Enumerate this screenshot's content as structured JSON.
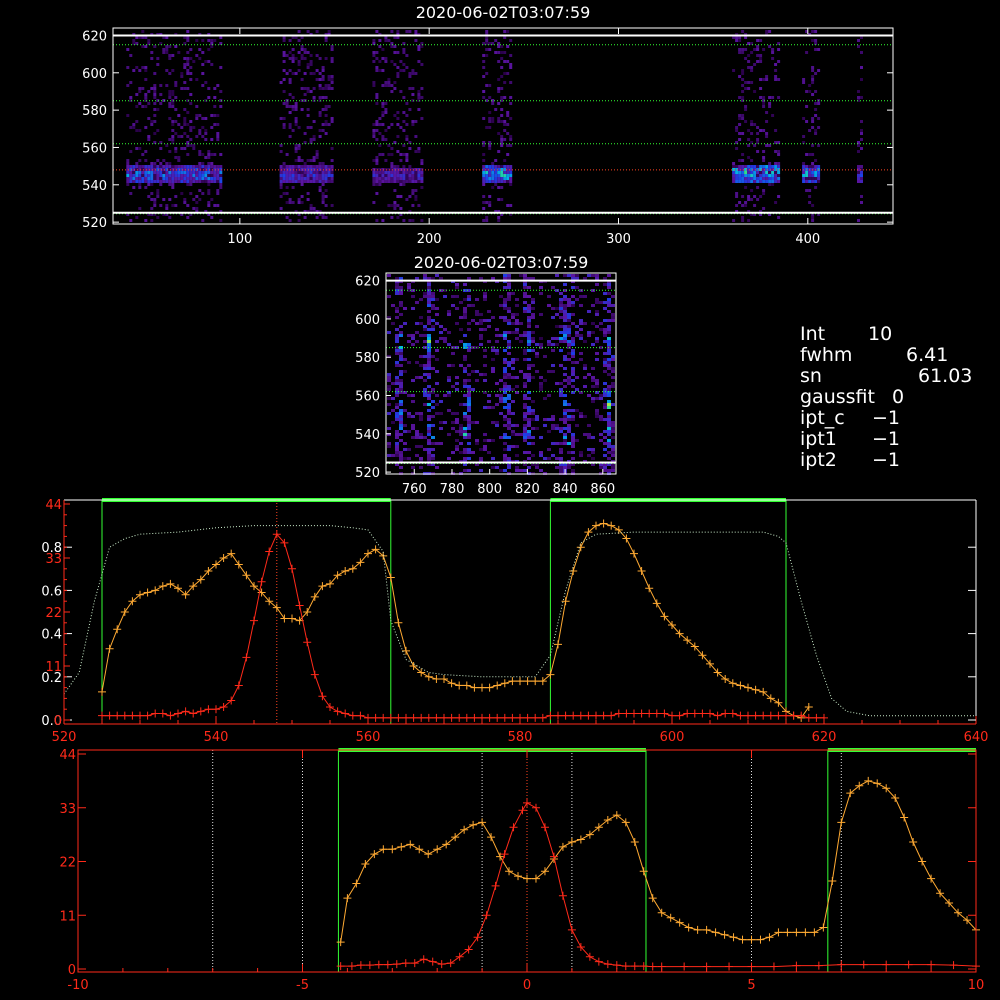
{
  "chart_data": [
    {
      "type": "heatmap",
      "title": "2020-06-02T03:07:59",
      "xlim": [
        33,
        445
      ],
      "ylim": [
        519,
        624
      ],
      "x_ticks": [
        100,
        200,
        300,
        400
      ],
      "y_ticks": [
        520,
        540,
        560,
        580,
        600,
        620
      ],
      "dotted_lines": [
        {
          "y": 615,
          "color": "#33ff33"
        },
        {
          "y": 585,
          "color": "#33ff33"
        },
        {
          "y": 562,
          "color": "#33ff33"
        },
        {
          "y": 548,
          "color": "#ff4422"
        },
        {
          "y": 524.5,
          "color": "#33ff33"
        }
      ],
      "solid_lines_y": [
        620,
        525
      ],
      "strips": [
        {
          "x0": 40,
          "x1": 90,
          "core": [
            541,
            551
          ],
          "intensity": 0.75
        },
        {
          "x0": 121,
          "x1": 148,
          "core": [
            541,
            551
          ],
          "intensity": 0.55
        },
        {
          "x0": 170,
          "x1": 196,
          "core": [
            542,
            550
          ],
          "intensity": 0.5
        },
        {
          "x0": 228,
          "x1": 243,
          "core": [
            542,
            551
          ],
          "intensity": 0.9
        },
        {
          "x0": 360,
          "x1": 384,
          "core": [
            542,
            552
          ],
          "intensity": 0.95
        },
        {
          "x0": 397,
          "x1": 406,
          "core": [
            542,
            551
          ],
          "intensity": 0.85
        },
        {
          "x0": 426,
          "x1": 429,
          "core": [
            542,
            551
          ],
          "intensity": 0.6
        }
      ]
    },
    {
      "type": "heatmap",
      "title": "2020-06-02T03:07:59",
      "xlim": [
        745,
        867
      ],
      "ylim": [
        519,
        624
      ],
      "x_ticks": [
        760,
        780,
        800,
        820,
        840,
        860
      ],
      "y_ticks": [
        520,
        540,
        560,
        580,
        600,
        620
      ],
      "dotted_lines": [
        {
          "y": 615,
          "color": "#33ff33"
        },
        {
          "y": 585,
          "color": "#33ff33"
        },
        {
          "y": 562,
          "color": "#33ff33"
        },
        {
          "y": 524.5,
          "color": "#33ff33"
        }
      ],
      "solid_lines_y": [
        620,
        525
      ],
      "hot_columns": [
        751,
        767,
        787,
        808,
        819,
        838,
        842,
        862
      ],
      "hot_rows": [
        557,
        588,
        540
      ]
    },
    {
      "type": "line",
      "xlim": [
        520,
        640
      ],
      "x_ticks": [
        520,
        540,
        560,
        580,
        600,
        620,
        640
      ],
      "left_axis_white": {
        "ylim": [
          0,
          1.0
        ],
        "ticks": [
          0.0,
          0.2,
          0.4,
          0.6,
          0.8
        ],
        "tick_labels": [
          "0.0",
          "0.2",
          "0.4",
          "0.6",
          "0.8"
        ]
      },
      "left_axis_red": {
        "ylim": [
          0,
          44
        ],
        "ticks": [
          0,
          11,
          22,
          33,
          44
        ],
        "tick_labels": [
          "0",
          "11",
          "22",
          "33",
          "44"
        ]
      },
      "green_windows": [
        [
          525,
          563
        ],
        [
          584,
          615
        ]
      ],
      "red_dotted_x": 548,
      "series": [
        {
          "color": "#ffaa33",
          "marker": "+",
          "x": [
            525,
            526,
            527,
            528,
            529,
            530,
            531,
            532,
            533,
            534,
            535,
            536,
            537,
            538,
            539,
            540,
            541,
            542,
            543,
            544,
            545,
            546,
            547,
            548,
            549,
            550,
            551,
            552,
            553,
            554,
            555,
            556,
            557,
            558,
            559,
            560,
            561,
            562,
            563,
            564,
            565,
            566,
            567,
            568,
            569,
            570,
            571,
            572,
            573,
            574,
            575,
            576,
            577,
            578,
            579,
            580,
            581,
            582,
            583,
            584,
            585,
            586,
            587,
            588,
            589,
            590,
            591,
            592,
            593,
            594,
            595,
            596,
            597,
            598,
            599,
            600,
            601,
            602,
            603,
            604,
            605,
            606,
            607,
            608,
            609,
            610,
            611,
            612,
            613,
            614,
            615,
            616,
            617,
            618
          ],
          "y": [
            0.13,
            0.33,
            0.42,
            0.5,
            0.55,
            0.58,
            0.59,
            0.6,
            0.62,
            0.63,
            0.61,
            0.58,
            0.62,
            0.65,
            0.69,
            0.72,
            0.75,
            0.77,
            0.72,
            0.67,
            0.62,
            0.59,
            0.55,
            0.52,
            0.47,
            0.47,
            0.46,
            0.5,
            0.57,
            0.62,
            0.63,
            0.67,
            0.69,
            0.7,
            0.73,
            0.77,
            0.79,
            0.76,
            0.66,
            0.45,
            0.32,
            0.25,
            0.22,
            0.2,
            0.19,
            0.19,
            0.17,
            0.16,
            0.16,
            0.15,
            0.15,
            0.15,
            0.16,
            0.17,
            0.18,
            0.18,
            0.18,
            0.18,
            0.18,
            0.21,
            0.35,
            0.55,
            0.69,
            0.8,
            0.87,
            0.9,
            0.91,
            0.9,
            0.88,
            0.84,
            0.77,
            0.69,
            0.61,
            0.54,
            0.48,
            0.44,
            0.4,
            0.37,
            0.34,
            0.3,
            0.26,
            0.22,
            0.19,
            0.17,
            0.16,
            0.15,
            0.14,
            0.13,
            0.1,
            0.08,
            0.04,
            0.02,
            0.01,
            0.06
          ]
        },
        {
          "color": "#ff2a1a",
          "marker": "+",
          "x": [
            525,
            526,
            527,
            528,
            529,
            530,
            531,
            532,
            533,
            534,
            535,
            536,
            537,
            538,
            539,
            540,
            541,
            542,
            543,
            544,
            545,
            546,
            547,
            548,
            549,
            550,
            551,
            552,
            553,
            554,
            555,
            556,
            557,
            558,
            559,
            560,
            561,
            562,
            563,
            564,
            565,
            566,
            567,
            568,
            569,
            570,
            571,
            572,
            573,
            574,
            575,
            576,
            577,
            578,
            579,
            580,
            581,
            582,
            583,
            584,
            585,
            586,
            587,
            588,
            589,
            590,
            591,
            592,
            593,
            594,
            595,
            596,
            597,
            598,
            599,
            600,
            601,
            602,
            603,
            604,
            605,
            606,
            607,
            608,
            609,
            610,
            611,
            612,
            613,
            614,
            615,
            616,
            617,
            618,
            619,
            620
          ],
          "y": [
            0.02,
            0.02,
            0.02,
            0.02,
            0.02,
            0.02,
            0.02,
            0.03,
            0.03,
            0.02,
            0.03,
            0.04,
            0.03,
            0.04,
            0.05,
            0.05,
            0.06,
            0.09,
            0.16,
            0.29,
            0.46,
            0.64,
            0.78,
            0.86,
            0.82,
            0.7,
            0.53,
            0.36,
            0.21,
            0.11,
            0.06,
            0.04,
            0.03,
            0.02,
            0.02,
            0.01,
            0.01,
            0.01,
            0.01,
            0.01,
            0.01,
            0.01,
            0.01,
            0.01,
            0.01,
            0.01,
            0.01,
            0.01,
            0.01,
            0.01,
            0.01,
            0.01,
            0.01,
            0.01,
            0.01,
            0.01,
            0.01,
            0.01,
            0.01,
            0.02,
            0.02,
            0.02,
            0.02,
            0.02,
            0.02,
            0.02,
            0.02,
            0.02,
            0.03,
            0.03,
            0.03,
            0.03,
            0.03,
            0.03,
            0.03,
            0.02,
            0.02,
            0.03,
            0.03,
            0.03,
            0.03,
            0.02,
            0.03,
            0.03,
            0.02,
            0.02,
            0.02,
            0.02,
            0.02,
            0.02,
            0.02,
            0.02,
            0.02,
            0.01,
            0.01,
            0.01
          ]
        },
        {
          "color": "#cceecc",
          "dotted": true,
          "x": [
            520,
            522,
            524,
            526,
            528,
            530,
            535,
            540,
            545,
            550,
            555,
            558,
            560,
            562,
            563,
            565,
            568,
            570,
            575,
            580,
            582,
            584,
            586,
            588,
            590,
            595,
            600,
            605,
            610,
            612,
            614,
            615,
            617,
            619,
            621,
            623,
            626,
            630,
            635,
            640
          ],
          "y": [
            0.12,
            0.22,
            0.55,
            0.8,
            0.84,
            0.86,
            0.87,
            0.89,
            0.9,
            0.9,
            0.9,
            0.89,
            0.88,
            0.78,
            0.46,
            0.28,
            0.22,
            0.21,
            0.2,
            0.2,
            0.2,
            0.3,
            0.6,
            0.82,
            0.86,
            0.87,
            0.87,
            0.87,
            0.87,
            0.87,
            0.85,
            0.82,
            0.55,
            0.3,
            0.1,
            0.04,
            0.02,
            0.02,
            0.02,
            0.02
          ]
        }
      ]
    },
    {
      "type": "line",
      "xlim": [
        -10,
        10
      ],
      "x_ticks": [
        -10,
        -5,
        0,
        5,
        10
      ],
      "y_axis_red": {
        "ylim": [
          0,
          44
        ],
        "ticks": [
          0,
          11,
          22,
          33,
          44
        ],
        "tick_labels": [
          "0",
          "11",
          "22",
          "33",
          "44"
        ]
      },
      "green_windows": [
        [
          -4.2,
          2.65
        ],
        [
          6.7,
          10
        ]
      ],
      "white_dotted_x": [
        -7,
        -5,
        -1,
        1,
        5,
        7
      ],
      "red_dotted_x": 0,
      "series": [
        {
          "color": "#ffaa33",
          "marker": "+",
          "x": [
            -4.15,
            -4.0,
            -3.8,
            -3.6,
            -3.4,
            -3.2,
            -3.0,
            -2.8,
            -2.6,
            -2.4,
            -2.2,
            -2.0,
            -1.8,
            -1.6,
            -1.4,
            -1.2,
            -1.0,
            -0.8,
            -0.6,
            -0.4,
            -0.2,
            0.0,
            0.2,
            0.4,
            0.6,
            0.8,
            1.0,
            1.2,
            1.4,
            1.6,
            1.8,
            2.0,
            2.2,
            2.4,
            2.6,
            2.8,
            3.0,
            3.2,
            3.4,
            3.6,
            3.8,
            4.0,
            4.2,
            4.4,
            4.6,
            4.8,
            5.0,
            5.2,
            5.4,
            5.6,
            5.8,
            6.0,
            6.2,
            6.4,
            6.6,
            6.8,
            7.0,
            7.2,
            7.4,
            7.6,
            7.8,
            8.0,
            8.2,
            8.4,
            8.6,
            8.8,
            9.0,
            9.2,
            9.4,
            9.6,
            9.8,
            10.0
          ],
          "y": [
            5.5,
            14.5,
            17.5,
            21.5,
            23.5,
            24.5,
            24.5,
            25,
            25.5,
            24.5,
            23.5,
            24.5,
            25.5,
            27,
            28.5,
            29.5,
            30,
            27,
            23,
            20,
            19,
            18.5,
            18.5,
            20,
            22.5,
            25,
            26,
            26.5,
            27.5,
            29,
            30.5,
            31.5,
            30,
            26,
            20,
            14.5,
            11.5,
            10.5,
            9.5,
            8.5,
            8,
            8,
            7.5,
            7,
            6.5,
            6,
            6,
            6,
            6.5,
            7.5,
            7.5,
            7.5,
            7.5,
            7.5,
            8.5,
            18,
            30,
            36,
            37.5,
            38.5,
            38,
            37,
            35,
            31,
            26,
            22,
            18.5,
            15.5,
            13.5,
            11.5,
            10,
            8
          ]
        },
        {
          "color": "#ff2a1a",
          "marker": "+",
          "x": [
            -4.15,
            -3.9,
            -3.7,
            -3.5,
            -3.3,
            -3.1,
            -2.9,
            -2.7,
            -2.5,
            -2.3,
            -2.1,
            -1.9,
            -1.7,
            -1.5,
            -1.3,
            -1.1,
            -0.9,
            -0.7,
            -0.5,
            -0.3,
            -0.1,
            0.0,
            0.2,
            0.4,
            0.6,
            0.8,
            1.0,
            1.2,
            1.4,
            1.6,
            1.8,
            2.0,
            2.2,
            2.4,
            2.6,
            2.8,
            3.0,
            3.5,
            4.0,
            4.5,
            5.0,
            5.5,
            6.0,
            6.5,
            7.0,
            7.5,
            8.0,
            8.5,
            9.0,
            9.5,
            10.0
          ],
          "y": [
            0.6,
            0.6,
            0.8,
            0.8,
            0.9,
            0.9,
            1,
            1.2,
            1.2,
            2,
            1.5,
            1,
            1.2,
            2.5,
            4,
            6.5,
            11,
            17,
            23.5,
            29,
            32.5,
            34,
            33,
            29,
            23,
            15,
            8,
            4.5,
            2.5,
            1.5,
            1,
            0.8,
            0.6,
            0.6,
            0.6,
            0.5,
            0.5,
            0.5,
            0.5,
            0.5,
            0.5,
            0.5,
            0.7,
            0.7,
            0.9,
            0.9,
            0.9,
            0.9,
            0.9,
            0.8,
            0.6
          ]
        }
      ]
    }
  ],
  "stats": [
    {
      "label": "Int",
      "value": "10"
    },
    {
      "label": "fwhm",
      "value": "6.41"
    },
    {
      "label": "sn",
      "value": "61.03"
    },
    {
      "label": "gaussfit",
      "value": "0"
    },
    {
      "label": "ipt_c",
      "value": "−1"
    },
    {
      "label": "ipt1",
      "value": "−1"
    },
    {
      "label": "ipt2",
      "value": "−1"
    }
  ]
}
